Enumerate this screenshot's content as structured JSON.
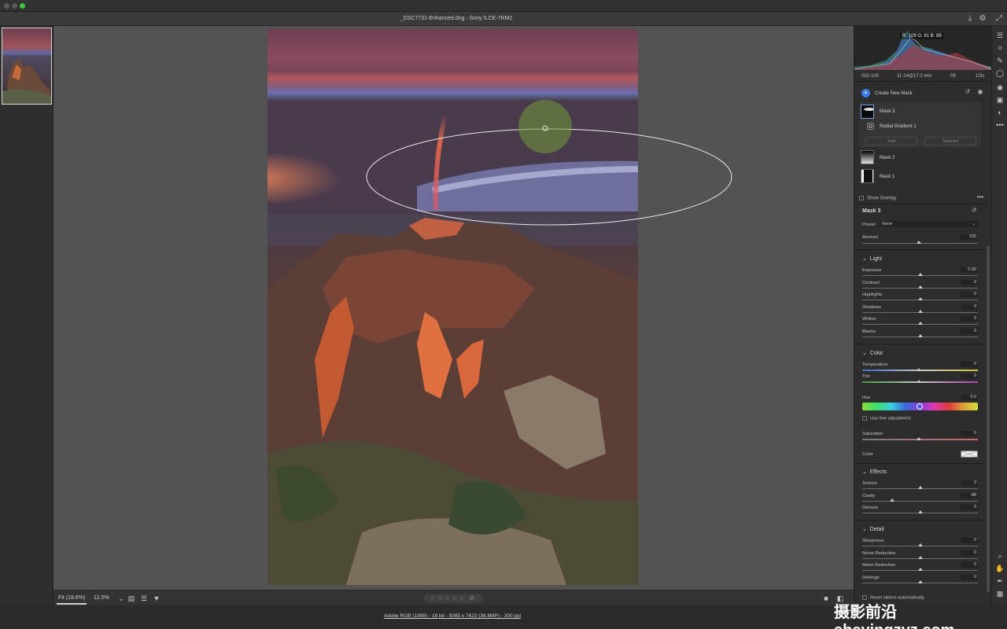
{
  "window": {
    "title": "_DSC7731-Enhanced.dng  -  Sony ILCE-7RM2"
  },
  "colors": {
    "accent": "#3d79e6",
    "panel_bg": "#2d2d2d",
    "canvas_bg": "#535353"
  },
  "histogram": {
    "rgb_readout": "R: 109   G: 81   B: 89"
  },
  "camera_info": {
    "iso": "ISO 100",
    "lens": "11-24@17.0 mm",
    "aperture": "f/9",
    "shutter": "1/3s"
  },
  "masks": {
    "create_label": "Create New Mask",
    "items": [
      {
        "label": "Mask 3"
      },
      {
        "label": "Radial Gradient 1"
      },
      {
        "label": "Mask 2"
      },
      {
        "label": "Mask 1"
      }
    ],
    "add_label": "Add",
    "subtract_label": "Subtract",
    "show_overlay_label": "Show Overlay"
  },
  "mask_settings": {
    "title": "Mask 3",
    "preset_label": "Preset",
    "preset_value": "None",
    "amount_label": "Amount",
    "amount_value": "100",
    "amount_level": 0.5
  },
  "light": {
    "title": "Light",
    "rows": [
      {
        "label": "Exposure",
        "value": "0.00",
        "level": 0.5
      },
      {
        "label": "Contrast",
        "value": "0",
        "level": 0.5
      },
      {
        "label": "Highlights",
        "value": "0",
        "level": 0.5
      },
      {
        "label": "Shadows",
        "value": "0",
        "level": 0.5
      },
      {
        "label": "Whites",
        "value": "0",
        "level": 0.5
      },
      {
        "label": "Blacks",
        "value": "0",
        "level": 0.5
      }
    ]
  },
  "color": {
    "title": "Color",
    "temperature_label": "Temperature",
    "temperature_value": "0",
    "tint_label": "Tint",
    "tint_value": "0",
    "hue_label": "Hue",
    "hue_value": "0.0",
    "fine_adjust_label": "Use fine adjustment",
    "saturation_label": "Saturation",
    "saturation_value": "0",
    "color_label": "Color"
  },
  "effects": {
    "title": "Effects",
    "rows": [
      {
        "label": "Texture",
        "value": "0",
        "level": 0.5
      },
      {
        "label": "Clarity",
        "value": "-48",
        "level": 0.26
      },
      {
        "label": "Dehaze",
        "value": "0",
        "level": 0.5
      }
    ]
  },
  "detail": {
    "title": "Detail",
    "rows": [
      {
        "label": "Sharpness",
        "value": "0",
        "level": 0.5
      },
      {
        "label": "Noise Reduction",
        "value": "0",
        "level": 0.5
      },
      {
        "label": "Moire Reduction",
        "value": "0",
        "level": 0.5
      },
      {
        "label": "Defringe",
        "value": "0",
        "level": 0.5
      }
    ],
    "reset_label": "Reset sliders automatically"
  },
  "bottom": {
    "zoom_fit": "Fit (18.6%)",
    "zoom_pct": "12.5%",
    "rating": "☆☆☆☆☆ ⊘"
  },
  "status": {
    "workflow": "Adobe RGB (1998) - 16 bit - 5085 x 7623 (38.8MP) - 300 ppi"
  },
  "watermark": "摄影前沿 sheyingzyz.com"
}
